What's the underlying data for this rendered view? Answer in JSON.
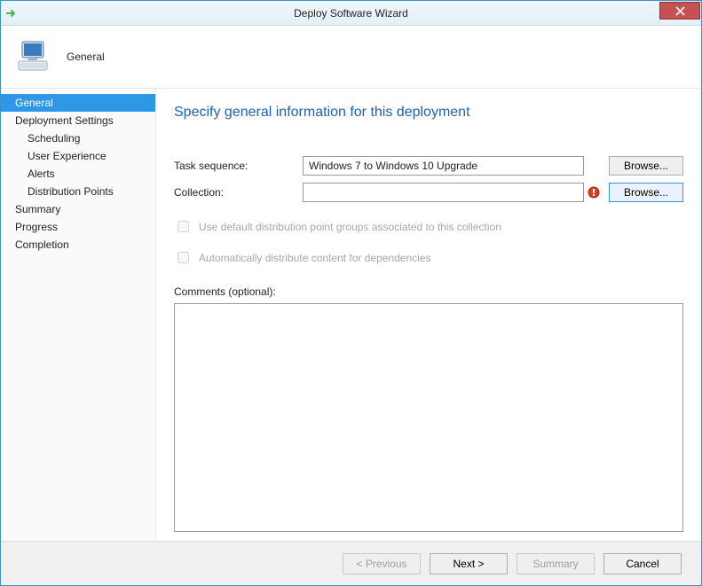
{
  "titlebar": {
    "title": "Deploy Software Wizard"
  },
  "banner": {
    "heading": "General"
  },
  "sidebar": {
    "items": [
      {
        "label": "General",
        "selected": true
      },
      {
        "label": "Deployment Settings"
      },
      {
        "label": "Scheduling",
        "sub": true
      },
      {
        "label": "User Experience",
        "sub": true
      },
      {
        "label": "Alerts",
        "sub": true
      },
      {
        "label": "Distribution Points",
        "sub": true
      },
      {
        "label": "Summary"
      },
      {
        "label": "Progress"
      },
      {
        "label": "Completion"
      }
    ]
  },
  "main": {
    "headline": "Specify general information for this deployment",
    "task_label": "Task sequence:",
    "task_value": "Windows 7 to Windows 10 Upgrade",
    "task_browse": "Browse...",
    "collection_label": "Collection:",
    "collection_value": "",
    "collection_browse": "Browse...",
    "check1": "Use default distribution point groups associated to this collection",
    "check2": "Automatically distribute content for dependencies",
    "comments_label": "Comments (optional):",
    "comments_value": ""
  },
  "footer": {
    "previous": "< Previous",
    "next": "Next >",
    "summary": "Summary",
    "cancel": "Cancel"
  }
}
